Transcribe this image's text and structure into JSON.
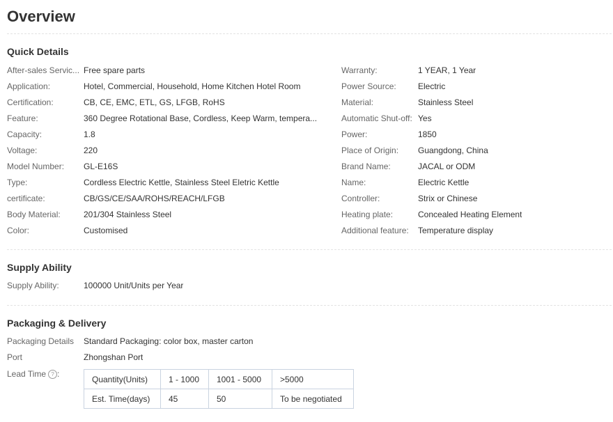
{
  "page": {
    "title": "Overview"
  },
  "quick_details": {
    "heading": "Quick Details",
    "left": [
      {
        "label": "After-sales Servic...",
        "value": "Free spare parts"
      },
      {
        "label": "Application:",
        "value": "Hotel, Commercial, Household, Home Kitchen Hotel Room"
      },
      {
        "label": "Certification:",
        "value": "CB, CE, EMC, ETL, GS, LFGB, RoHS"
      },
      {
        "label": "Feature:",
        "value": "360 Degree Rotational Base, Cordless, Keep Warm, tempera..."
      },
      {
        "label": "Capacity:",
        "value": "1.8"
      },
      {
        "label": "Voltage:",
        "value": "220"
      },
      {
        "label": "Model Number:",
        "value": "GL-E16S"
      },
      {
        "label": "Type:",
        "value": "Cordless Electric Kettle, Stainless Steel Eletric Kettle"
      },
      {
        "label": "certificate:",
        "value": "CB/GS/CE/SAA/ROHS/REACH/LFGB"
      },
      {
        "label": "Body Material:",
        "value": "201/304 Stainless Steel"
      },
      {
        "label": "Color:",
        "value": "Customised"
      }
    ],
    "right": [
      {
        "label": "Warranty:",
        "value": "1 YEAR, 1 Year"
      },
      {
        "label": "Power Source:",
        "value": "Electric"
      },
      {
        "label": "Material:",
        "value": "Stainless Steel"
      },
      {
        "label": "Automatic Shut-off:",
        "value": "Yes"
      },
      {
        "label": "Power:",
        "value": "1850"
      },
      {
        "label": "Place of Origin:",
        "value": "Guangdong, China"
      },
      {
        "label": "Brand Name:",
        "value": "JACAL or ODM"
      },
      {
        "label": "Name:",
        "value": "Electric Kettle"
      },
      {
        "label": "Controller:",
        "value": "Strix or Chinese"
      },
      {
        "label": "Heating plate:",
        "value": "Concealed Heating Element"
      },
      {
        "label": "Additional feature:",
        "value": "Temperature display"
      }
    ]
  },
  "supply_ability": {
    "heading": "Supply Ability",
    "label": "Supply Ability:",
    "value": "100000 Unit/Units per Year"
  },
  "packaging": {
    "heading": "Packaging & Delivery",
    "details_label": "Packaging Details",
    "details_value": "Standard Packaging: color box, master carton",
    "port_label": "Port",
    "port_value": "Zhongshan Port",
    "lead_time_label": "Lead Time",
    "help_icon": "?",
    "lead_table": [
      [
        "Quantity(Units)",
        "1 - 1000",
        "1001 - 5000",
        ">5000"
      ],
      [
        "Est. Time(days)",
        "45",
        "50",
        "To be negotiated"
      ]
    ]
  }
}
